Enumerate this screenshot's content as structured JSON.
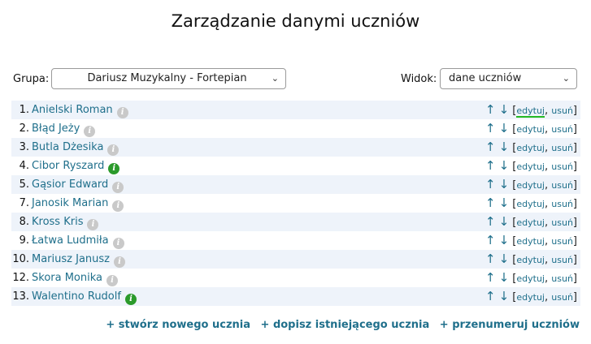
{
  "title": "Zarządzanie danymi uczniów",
  "filters": {
    "group_label": "Grupa:",
    "group_value": "Dariusz Muzykalny - Fortepian",
    "view_label": "Widok:",
    "view_value": "dane uczniów"
  },
  "students": [
    {
      "num": "1.",
      "name": "Anielski Roman",
      "info": "gray"
    },
    {
      "num": "2.",
      "name": "Błąd Jeży",
      "info": "gray"
    },
    {
      "num": "3.",
      "name": "Butla Dżesika",
      "info": "gray"
    },
    {
      "num": "4.",
      "name": "Cibor Ryszard",
      "info": "green"
    },
    {
      "num": "5.",
      "name": "Gąsior Edward",
      "info": "gray"
    },
    {
      "num": "7.",
      "name": "Janosik Marian",
      "info": "gray"
    },
    {
      "num": "8.",
      "name": "Kross Kris",
      "info": "gray"
    },
    {
      "num": "9.",
      "name": "Łatwa Ludmiła",
      "info": "gray"
    },
    {
      "num": "10.",
      "name": "Mariusz Janusz",
      "info": "gray"
    },
    {
      "num": "12.",
      "name": "Skora Monika",
      "info": "gray"
    },
    {
      "num": "13.",
      "name": "Walentino Rudolf",
      "info": "green"
    }
  ],
  "row_actions": {
    "up": "↑",
    "down": "↓",
    "open": "[",
    "edit": "edytuj",
    "sep": ",",
    "delete": "usuń",
    "close": "]"
  },
  "bottom_links": {
    "create": "+ stwórz nowego ucznia",
    "append": "+ dopisz istniejącego ucznia",
    "renumber": "+ przenumeruj uczniów"
  },
  "icons": {
    "info": "info-icon",
    "select_chevron": "chevron-down-icon"
  },
  "colors": {
    "link": "#1f6f8b",
    "row_bg": "#eef3fa",
    "info_green": "#2b9a2b",
    "info_gray": "#c9c9c9",
    "focus_underline": "#22b822"
  }
}
